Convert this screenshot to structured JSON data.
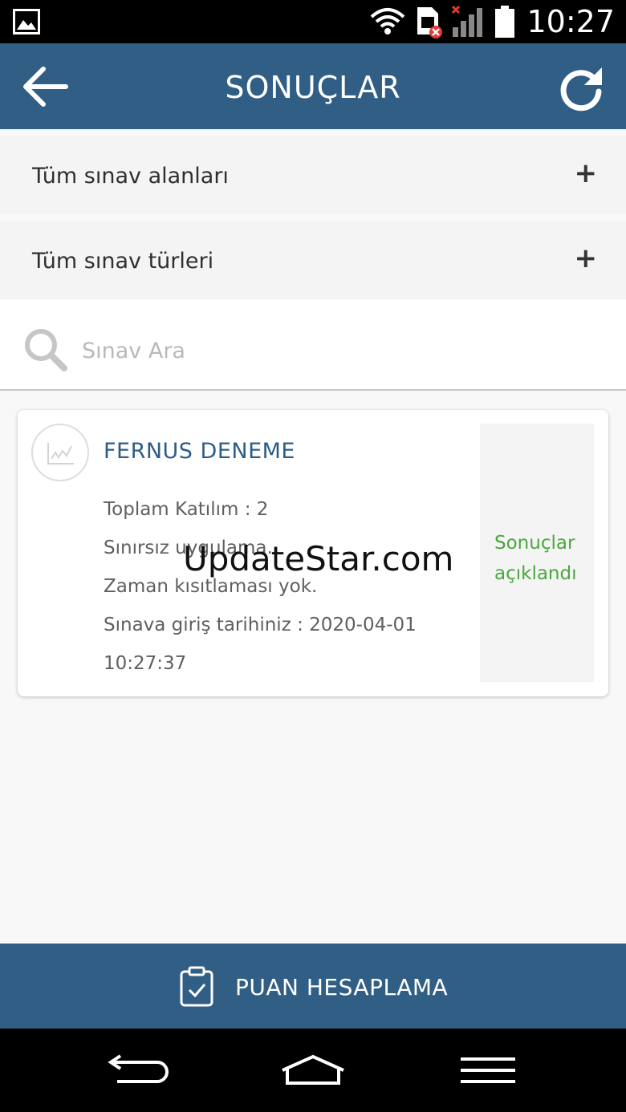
{
  "status_bar": {
    "time": "10:27",
    "icons": [
      "image-notification-icon",
      "wifi-icon",
      "sim-error-icon",
      "signal-icon",
      "battery-icon"
    ]
  },
  "app_bar": {
    "title": "SONUÇLAR",
    "back_icon": "arrow-left-icon",
    "refresh_icon": "refresh-icon"
  },
  "filters": [
    {
      "label": "Tüm sınav alanları",
      "icon": "+"
    },
    {
      "label": "Tüm sınav türleri",
      "icon": "+"
    }
  ],
  "search": {
    "placeholder": "Sınav Ara"
  },
  "results": [
    {
      "title": "FERNUS DENEME",
      "total_participation": "Toplam Katılım : 2",
      "unlimited": "Sınırsız uygulama.",
      "time_limit": "Zaman kısıtlaması yok.",
      "entry_date_label": "Sınava giriş tarihiniz : 2020-04-01",
      "entry_time": "10:27:37",
      "status": "Sonuçlar açıklandı"
    }
  ],
  "watermark": "UpdateStar.com",
  "bottom_action": {
    "label": "PUAN HESAPLAMA",
    "icon": "clipboard-check-icon"
  },
  "colors": {
    "primary": "#315e85",
    "status_green": "#4aa83e",
    "title_blue": "#2e5d85"
  }
}
